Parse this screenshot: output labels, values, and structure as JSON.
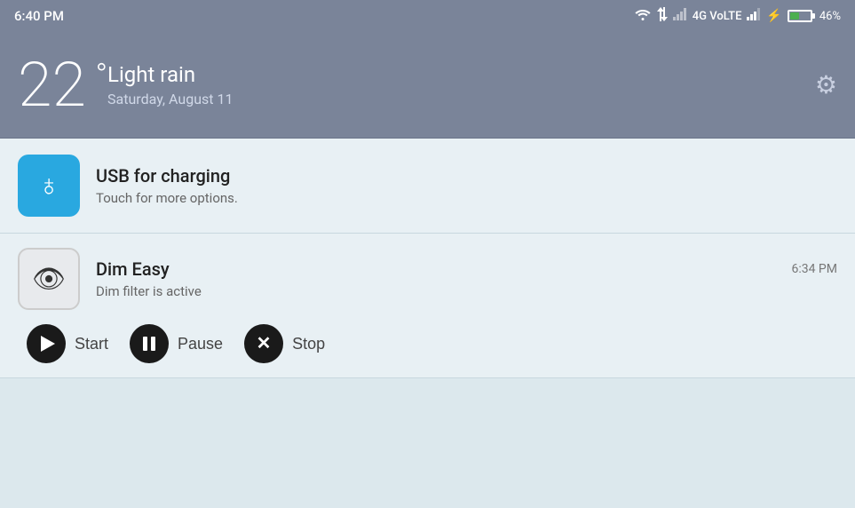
{
  "statusBar": {
    "time": "6:40 PM",
    "signal4g": "4G VoLTE",
    "batteryPercent": "46%",
    "batteryLevel": 46
  },
  "weather": {
    "temperature": "22",
    "degree": "°",
    "condition": "Light rain",
    "date": "Saturday, August 11"
  },
  "notifications": {
    "usb": {
      "title": "USB for charging",
      "subtitle": "Touch for more options."
    },
    "dimEasy": {
      "title": "Dim Easy",
      "time": "6:34 PM",
      "subtitle": "Dim filter is active"
    }
  },
  "actions": {
    "start": "Start",
    "pause": "Pause",
    "stop": "Stop"
  }
}
